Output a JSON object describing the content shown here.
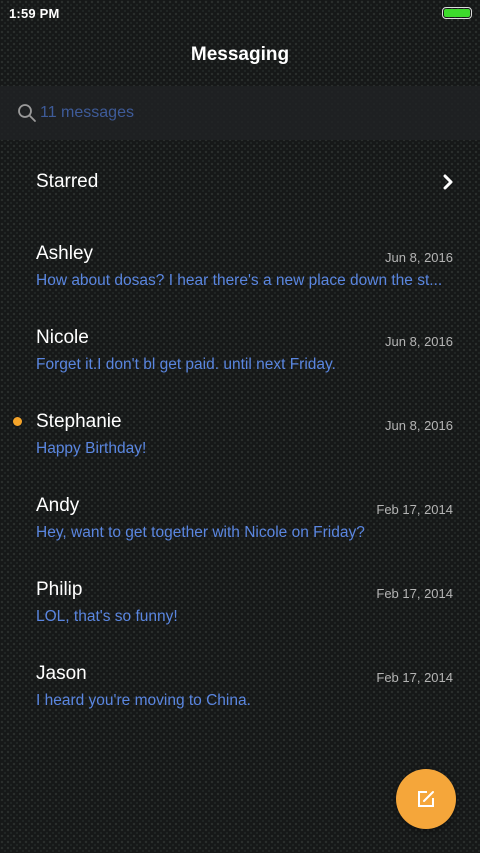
{
  "status_bar": {
    "time": "1:59 PM",
    "battery_level": 1.0,
    "battery_color": "#3ddc2c"
  },
  "header": {
    "title": "Messaging"
  },
  "search": {
    "placeholder": "11 messages",
    "icon": "search-icon"
  },
  "starred": {
    "label": "Starred",
    "icon": "chevron-right-icon"
  },
  "conversations": [
    {
      "name": "Ashley",
      "date": "Jun 8, 2016",
      "snippet": "How about dosas? I hear there's a new place down the st...",
      "unread": false
    },
    {
      "name": "Nicole",
      "date": "Jun 8, 2016",
      "snippet": "Forget it.I don't bl get paid. until next Friday.",
      "unread": false
    },
    {
      "name": "Stephanie",
      "date": "Jun 8, 2016",
      "snippet": "Happy Birthday!",
      "unread": true
    },
    {
      "name": "Andy",
      "date": "Feb 17, 2014",
      "snippet": "Hey, want to get together with Nicole on Friday?",
      "unread": false
    },
    {
      "name": "Philip",
      "date": "Feb 17, 2014",
      "snippet": "LOL, that's so funny!",
      "unread": false
    },
    {
      "name": "Jason",
      "date": "Feb 17, 2014",
      "snippet": "I heard you're moving to China.",
      "unread": false
    }
  ],
  "fab": {
    "icon": "compose-icon",
    "color": "#f5a63a"
  },
  "colors": {
    "accent": "#f5a42a",
    "snippet": "#5a86e0",
    "background": "#161818"
  }
}
